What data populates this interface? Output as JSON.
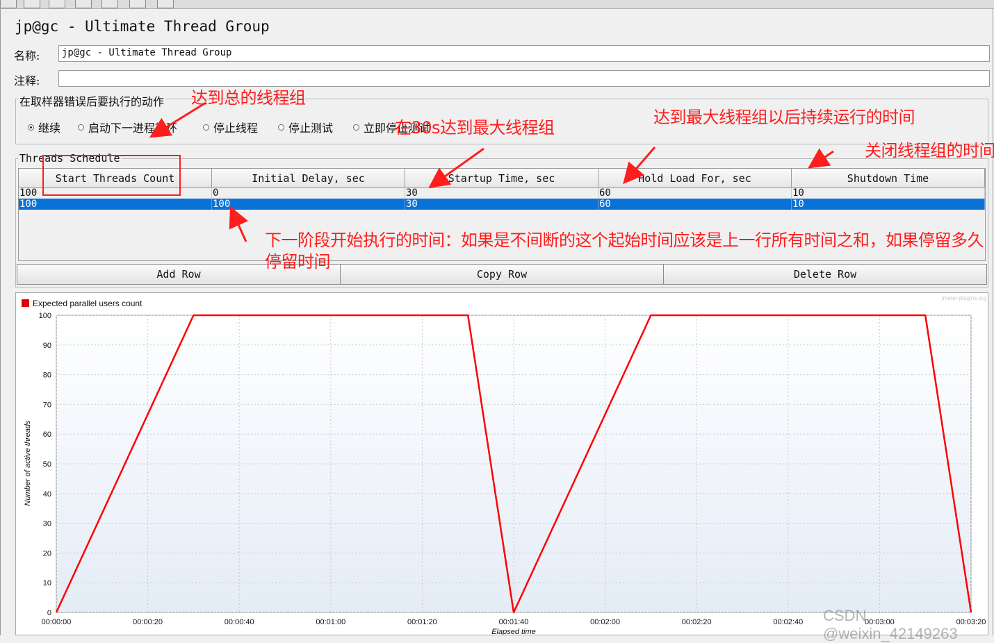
{
  "window": {
    "title": "jp@gc - Ultimate Thread Group"
  },
  "form": {
    "name_label": "名称:",
    "name_value": "jp@gc - Ultimate Thread Group",
    "comment_label": "注释:",
    "comment_value": ""
  },
  "error_action": {
    "title": "在取样器错误后要执行的动作",
    "options": [
      {
        "label": "继续",
        "selected": true
      },
      {
        "label": "启动下一进程循环",
        "selected": false
      },
      {
        "label": "停止线程",
        "selected": false
      },
      {
        "label": "停止测试",
        "selected": false
      },
      {
        "label": "立即停止测试",
        "selected": false
      }
    ]
  },
  "schedule": {
    "title": "Threads Schedule",
    "columns": [
      "Start Threads Count",
      "Initial Delay, sec",
      "Startup Time, sec",
      "Hold Load For, sec",
      "Shutdown Time"
    ],
    "rows": [
      [
        "100",
        "0",
        "30",
        "60",
        "10"
      ],
      [
        "100",
        "100",
        "30",
        "60",
        "10"
      ]
    ],
    "selected_row": 1,
    "buttons": {
      "add": "Add Row",
      "copy": "Copy Row",
      "delete": "Delete Row"
    }
  },
  "chart_data": {
    "type": "line",
    "legend": "Expected parallel users count",
    "watermark": "jmeter-plugins.org",
    "xlabel": "Elapsed time",
    "ylabel": "Number of active threads",
    "ylim": [
      0,
      100
    ],
    "yticks": [
      "0",
      "10",
      "20",
      "30",
      "40",
      "50",
      "60",
      "70",
      "80",
      "90",
      "100"
    ],
    "xticks": [
      "00:00:00",
      "00:00:20",
      "00:00:40",
      "00:01:00",
      "00:01:20",
      "00:01:40",
      "00:02:00",
      "00:02:20",
      "00:02:40",
      "00:03:00",
      "00:03:20"
    ],
    "xlim_sec": [
      0,
      200
    ],
    "series": [
      {
        "name": "Expected parallel users count",
        "color": "#ff0000",
        "x_sec": [
          0,
          30,
          90,
          100,
          130,
          190,
          200
        ],
        "y": [
          0,
          100,
          100,
          0,
          100,
          100,
          0
        ]
      }
    ],
    "grid": true,
    "legend_position": "top-left"
  },
  "annotations": {
    "a1": "达到总的线程组",
    "a2": "在30s达到最大线程组",
    "a3": "达到最大线程组以后持续运行的时间",
    "a4": "关闭线程组的时间",
    "a5_line1": "下一阶段开始执行的时间：如果是不间断的这个起始时间应该是上一行所有时间之和，如果停留多久",
    "a5_line2": "停留时间",
    "color": "#ff1d1d"
  },
  "footer": {
    "watermark": "CSDN @weixin_42149263"
  }
}
